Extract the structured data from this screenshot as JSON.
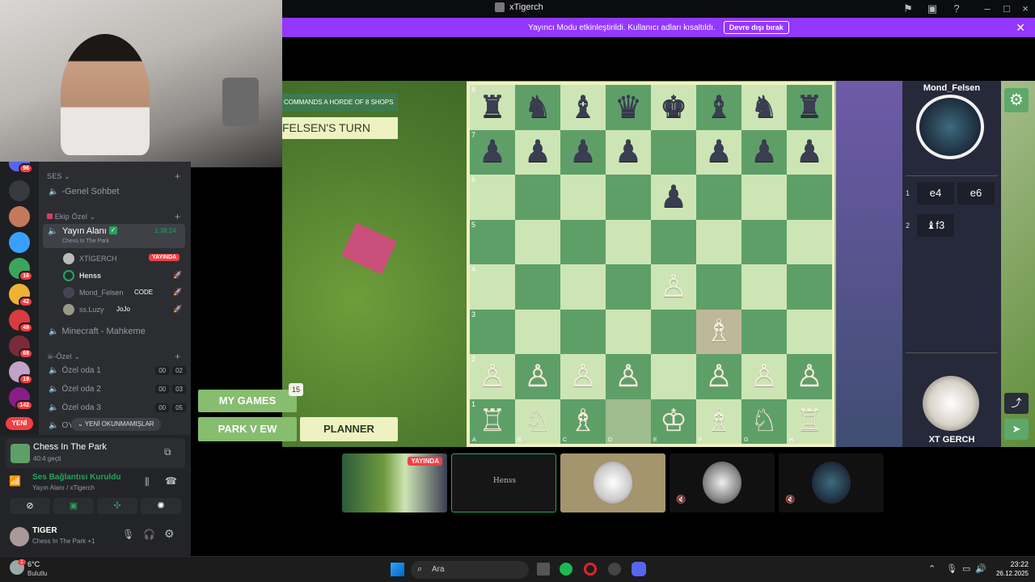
{
  "titlebar": {
    "title": "xTigerch"
  },
  "notice": {
    "text": "Yayıncı Modu etkinleştirildi. Kullanıcı adları kısaltıldı.",
    "button": "Devre dışı bırak"
  },
  "guild_badges": [
    "96",
    "16",
    "42",
    "49",
    "68",
    "19",
    "142"
  ],
  "guild_new": "YENİ",
  "sidebar": {
    "ses_category": "SES",
    "genel": "-Genel Sohbet",
    "ekip_category": "Ekip Özel",
    "yayin_alani": "Yayın Alanı",
    "yayin_timer": "1:38:24",
    "yayin_sub": "Chess In The Park",
    "users": [
      {
        "name": "XTİGERCH",
        "badge": "YAYINDA"
      },
      {
        "name": "Henss"
      },
      {
        "name": "Mond_Felsen",
        "badge": "CODE"
      },
      {
        "name": "ss.Luzy",
        "badge": "JoJo"
      }
    ],
    "minecraft": "Minecraft - Mahkeme",
    "ozel_category": "-Özel",
    "ozel_rooms": [
      {
        "name": "Özel oda 1",
        "a": "00",
        "b": "02"
      },
      {
        "name": "Özel oda 2",
        "a": "00",
        "b": "03"
      },
      {
        "name": "Özel oda 3",
        "a": "00",
        "b": "05"
      }
    ],
    "unread_label": "YENİ OKUNMAMIŞLAR",
    "partial_room": "OY"
  },
  "activity": {
    "title": "Chess In The Park",
    "sub": "40:4 geçti"
  },
  "voice": {
    "status": "Ses Bağlantısı Kuruldu",
    "sub": "Yayın Alanı / xTigerch"
  },
  "user": {
    "name": "TIGER",
    "status": "Chess In The Park +1"
  },
  "game": {
    "banner_top": "COMMANDS A HORDE OF 8 SHOPS",
    "turn": "FELSEN'S TURN",
    "my_games": "MY GAMES",
    "my_games_count": "15",
    "park_view": "PARK V EW",
    "planner": "PLANNER",
    "opponent": "Mond_Felsen",
    "player": "XT GERCH",
    "moves": [
      {
        "n": "1",
        "w": "e4",
        "b": "e6"
      },
      {
        "n": "2",
        "w": "♝f3",
        "b": ""
      }
    ],
    "ranks": [
      "8",
      "7",
      "6",
      "5",
      "4",
      "3",
      "2",
      "1"
    ],
    "files": [
      "A",
      "B",
      "C",
      "D",
      "E",
      "F",
      "G",
      "H"
    ]
  },
  "thumb_live": "YAYINDA",
  "thumb_name": "Henss",
  "taskbar": {
    "temp": "6°C",
    "weather": "Bulutlu",
    "search": "Ara",
    "time": "23:22",
    "date": "26.12.2025",
    "weather_badge": "1"
  },
  "colors": {
    "accent": "#9437ff",
    "board_light": "#cde5b4",
    "board_dark": "#5e9f68",
    "live": "#f23f43",
    "green": "#23a55a"
  }
}
